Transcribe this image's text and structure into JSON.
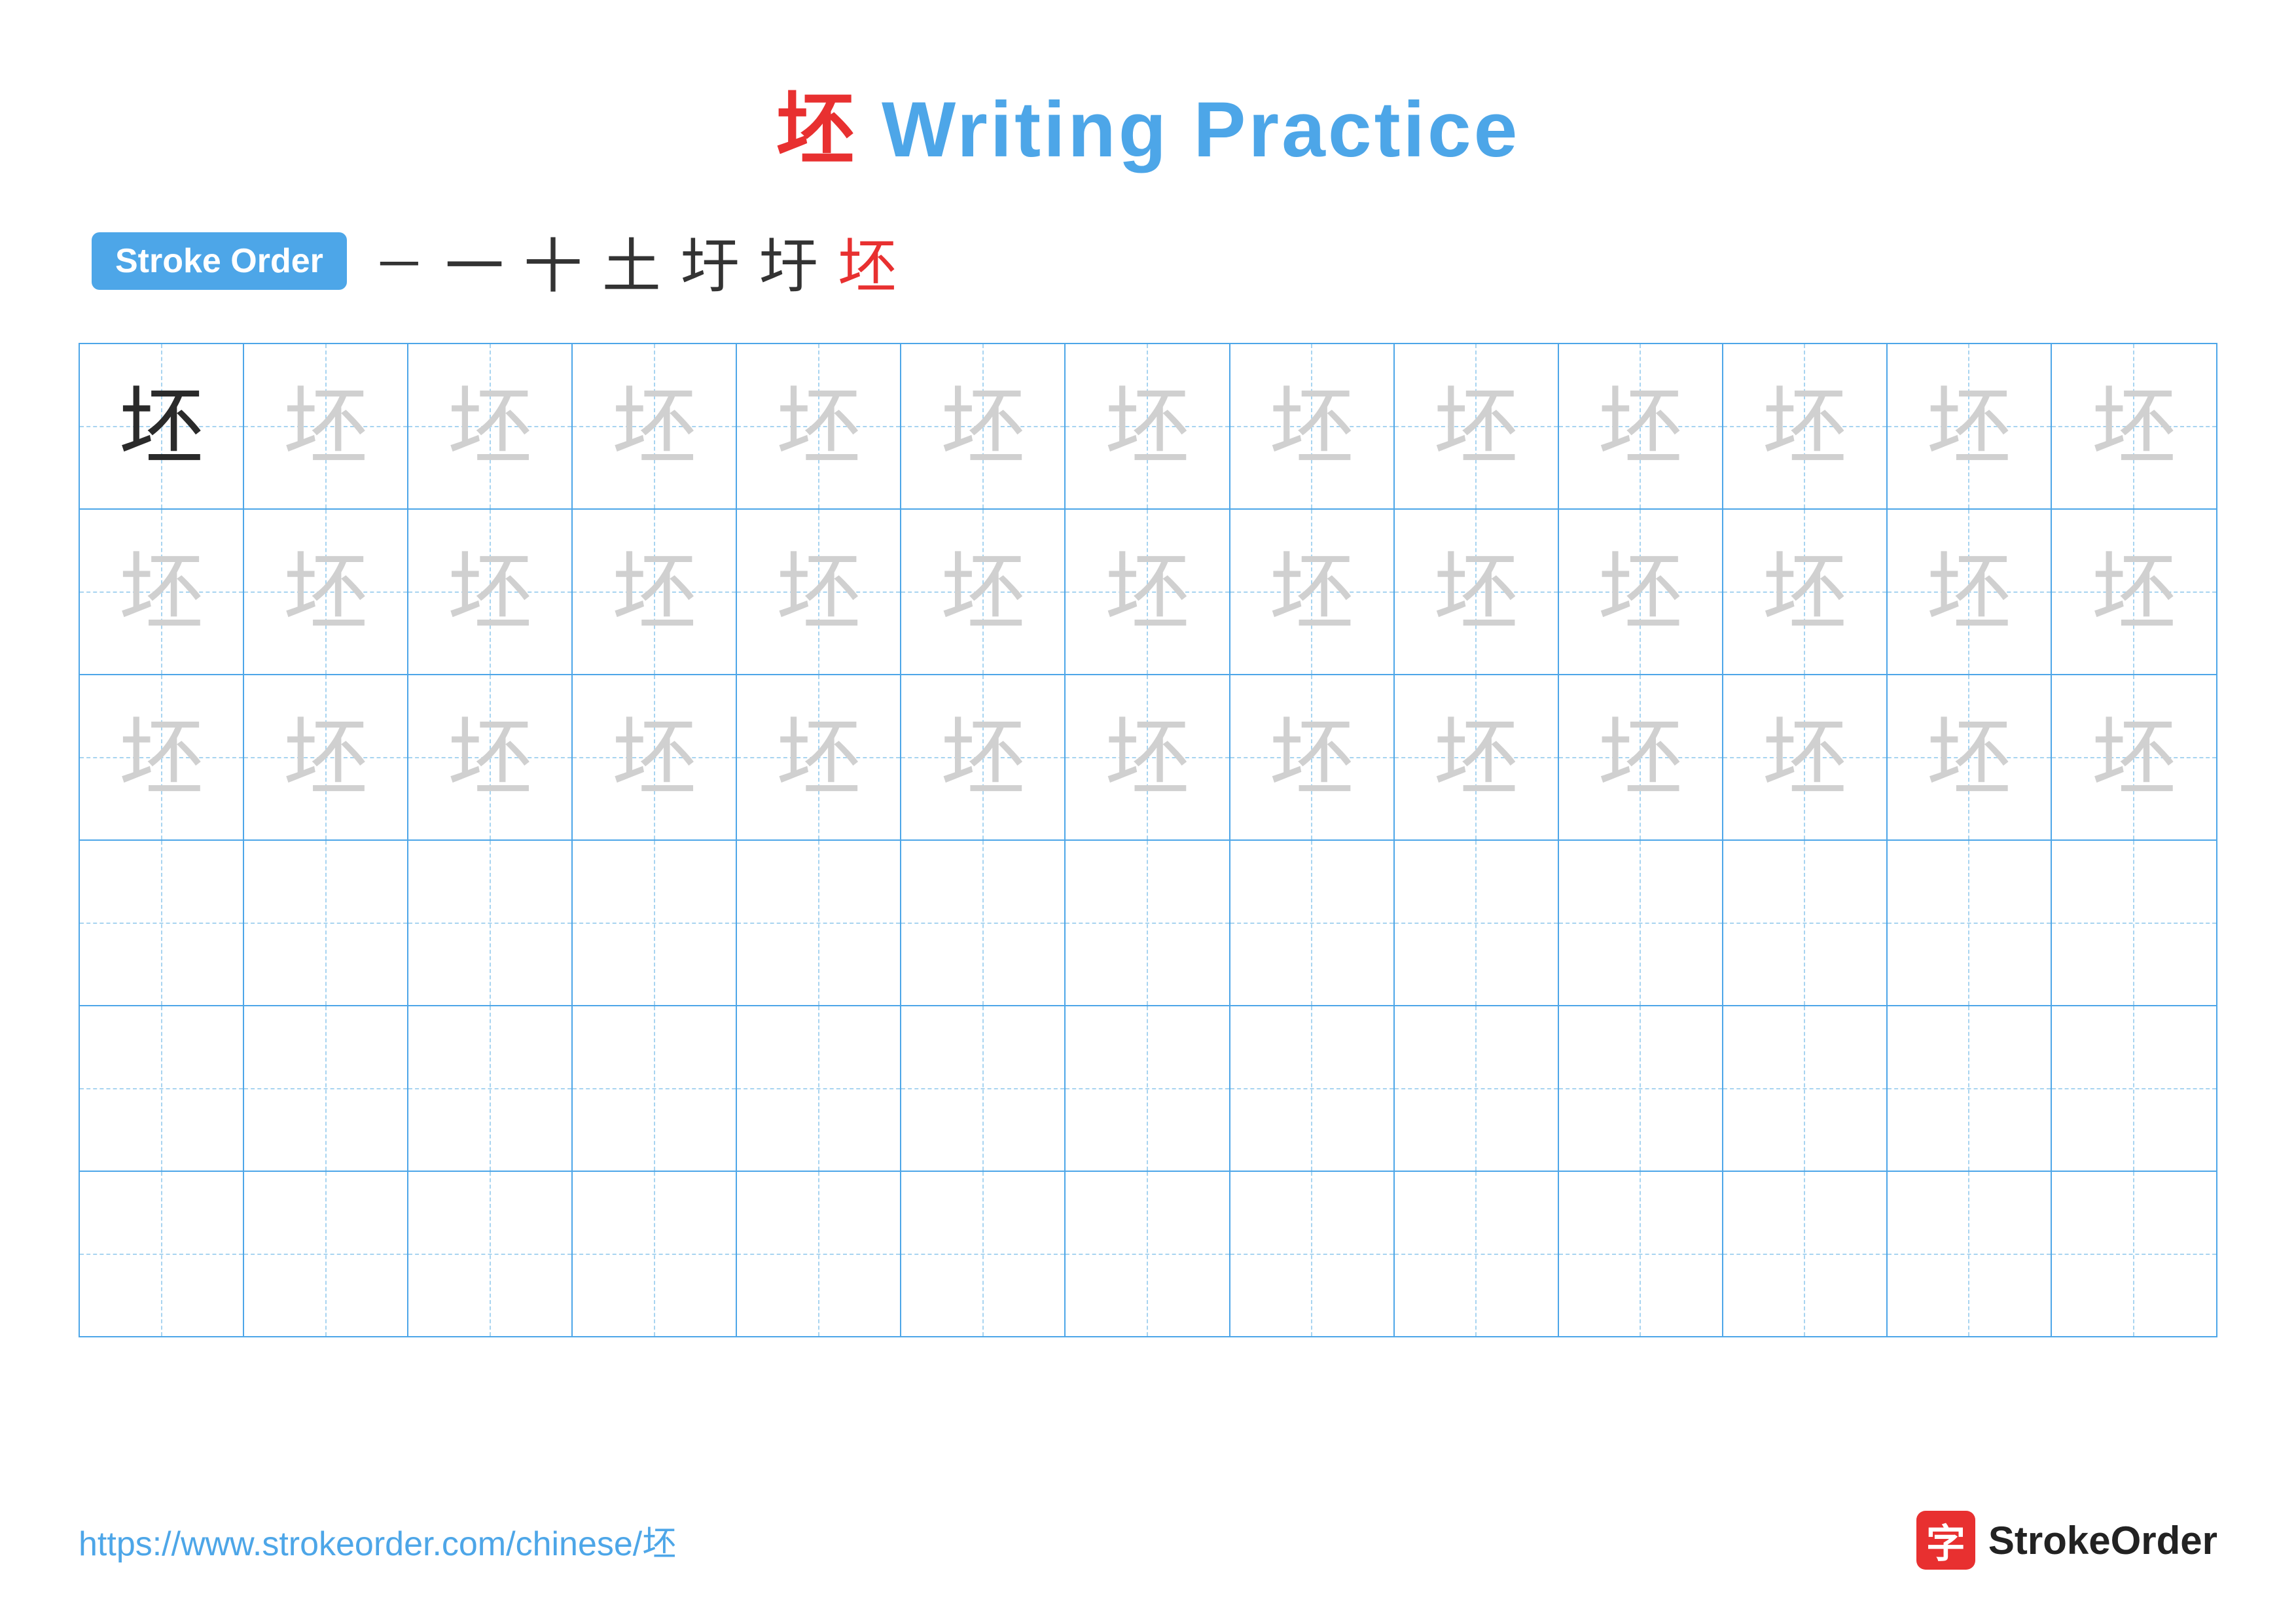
{
  "title": {
    "chinese": "坯",
    "rest": " Writing Practice"
  },
  "stroke_order": {
    "badge_label": "Stroke Order",
    "strokes": [
      "一",
      "十",
      "土",
      "圩",
      "圩",
      "坯"
    ]
  },
  "grid": {
    "rows": 6,
    "cols": 13,
    "character": "坯",
    "filled_rows": [
      {
        "type": "first_dark",
        "dark_count": 1,
        "light_count": 12
      },
      {
        "type": "light",
        "dark_count": 0,
        "light_count": 13
      },
      {
        "type": "light",
        "dark_count": 0,
        "light_count": 13
      },
      {
        "type": "empty",
        "dark_count": 0,
        "light_count": 0
      },
      {
        "type": "empty",
        "dark_count": 0,
        "light_count": 0
      },
      {
        "type": "empty",
        "dark_count": 0,
        "light_count": 0
      }
    ]
  },
  "footer": {
    "url": "https://www.strokeorder.com/chinese/坯",
    "logo_text": "StrokeOrder"
  }
}
